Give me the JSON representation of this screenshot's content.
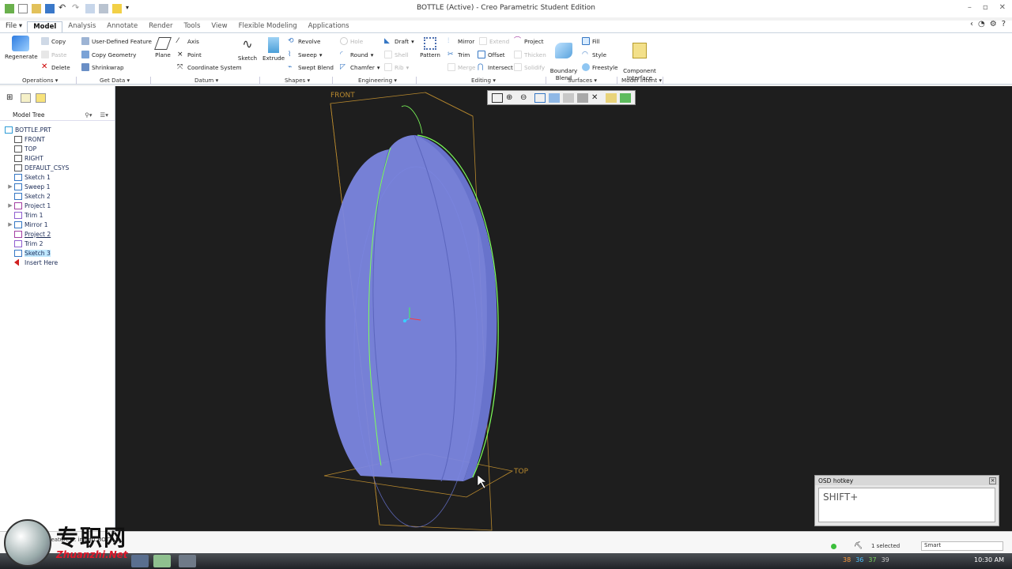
{
  "window": {
    "title": "BOTTLE (Active) - Creo Parametric Student Edition"
  },
  "menu": {
    "file": "File ▾",
    "tabs": [
      "Model",
      "Analysis",
      "Annotate",
      "Render",
      "Tools",
      "View",
      "Flexible Modeling",
      "Applications"
    ],
    "active_tab": "Model"
  },
  "ribbon": {
    "operations": {
      "regenerate": "Regenerate",
      "copy": "Copy",
      "paste": "Paste",
      "delete": "Delete",
      "udf": "User-Defined Feature",
      "copy_geometry": "Copy Geometry",
      "shrinkwrap": "Shrinkwrap"
    },
    "datum": {
      "plane": "Plane",
      "axis": "Axis",
      "point": "Point",
      "csys": "Coordinate System",
      "sketch": "Sketch"
    },
    "shapes": {
      "extrude": "Extrude",
      "revolve": "Revolve",
      "sweep": "Sweep",
      "swept_blend": "Swept Blend"
    },
    "engineering": {
      "hole": "Hole",
      "round": "Round",
      "chamfer": "Chamfer",
      "draft": "Draft",
      "shell": "Shell",
      "rib": "Rib"
    },
    "editing": {
      "pattern": "Pattern",
      "mirror": "Mirror",
      "trim": "Trim",
      "merge": "Merge",
      "extend": "Extend",
      "offset": "Offset",
      "intersect": "Intersect",
      "project": "Project",
      "thicken": "Thicken",
      "solidify": "Solidify"
    },
    "surfaces": {
      "boundary_blend": "Boundary\nBlend",
      "fill": "Fill",
      "style": "Style",
      "freestyle": "Freestyle"
    },
    "model_intent": {
      "component_interface": "Component\nInterface"
    },
    "groups": [
      "Operations ▾",
      "Get Data ▾",
      "Datum ▾",
      "Shapes ▾",
      "Engineering ▾",
      "Editing ▾",
      "Surfaces ▾",
      "Model Intent ▾"
    ]
  },
  "model_tree": {
    "header": "Model Tree",
    "items": [
      {
        "label": "BOTTLE.PRT",
        "icon": "part-icon",
        "expandable": false,
        "indent": 0
      },
      {
        "label": "FRONT",
        "icon": "datum-plane-icon",
        "expandable": false,
        "indent": 1
      },
      {
        "label": "TOP",
        "icon": "datum-plane-icon",
        "expandable": false,
        "indent": 1
      },
      {
        "label": "RIGHT",
        "icon": "datum-plane-icon",
        "expandable": false,
        "indent": 1
      },
      {
        "label": "DEFAULT_CSYS",
        "icon": "csys-icon",
        "expandable": false,
        "indent": 1
      },
      {
        "label": "Sketch 1",
        "icon": "sketch-icon",
        "expandable": false,
        "indent": 1
      },
      {
        "label": "Sweep 1",
        "icon": "sweep-icon",
        "expandable": true,
        "indent": 1
      },
      {
        "label": "Sketch 2",
        "icon": "sketch-icon",
        "expandable": false,
        "indent": 1
      },
      {
        "label": "Project 1",
        "icon": "project-icon",
        "expandable": true,
        "indent": 1
      },
      {
        "label": "Trim 1",
        "icon": "trim-icon",
        "expandable": false,
        "indent": 1
      },
      {
        "label": "Mirror 1",
        "icon": "mirror-icon",
        "expandable": true,
        "indent": 1
      },
      {
        "label": "Project 2",
        "icon": "project-icon",
        "expandable": false,
        "indent": 1
      },
      {
        "label": "Trim 2",
        "icon": "trim-icon",
        "expandable": false,
        "indent": 1
      },
      {
        "label": "Sketch 3",
        "icon": "sketch-icon",
        "expandable": false,
        "indent": 1
      },
      {
        "label": "Insert Here",
        "icon": "insert-arrow-icon",
        "expandable": false,
        "indent": 1
      }
    ],
    "selected": "Sketch 3"
  },
  "viewport": {
    "labels": {
      "front": "FRONT",
      "top": "TOP"
    },
    "osd": {
      "title": "OSD hotkey",
      "text": "SHIFT+"
    }
  },
  "statusbar": {
    "message": "feature ... in part BOTTLE.",
    "selected": "1 selected",
    "filter": "Smart"
  },
  "taskbar": {
    "clock": "10:30 AM",
    "tray": [
      "38",
      "36",
      "37",
      "39"
    ]
  },
  "watermark": {
    "cn": "专职网",
    "en": "Zhuanzhi.Net"
  },
  "colors": {
    "viewport_bg": "#1e1e1e",
    "part_fill": "#7b86e0",
    "datum_plane": "#b8892e",
    "edge_highlight": "#7dff5a",
    "selection": "#bfe8ff"
  }
}
